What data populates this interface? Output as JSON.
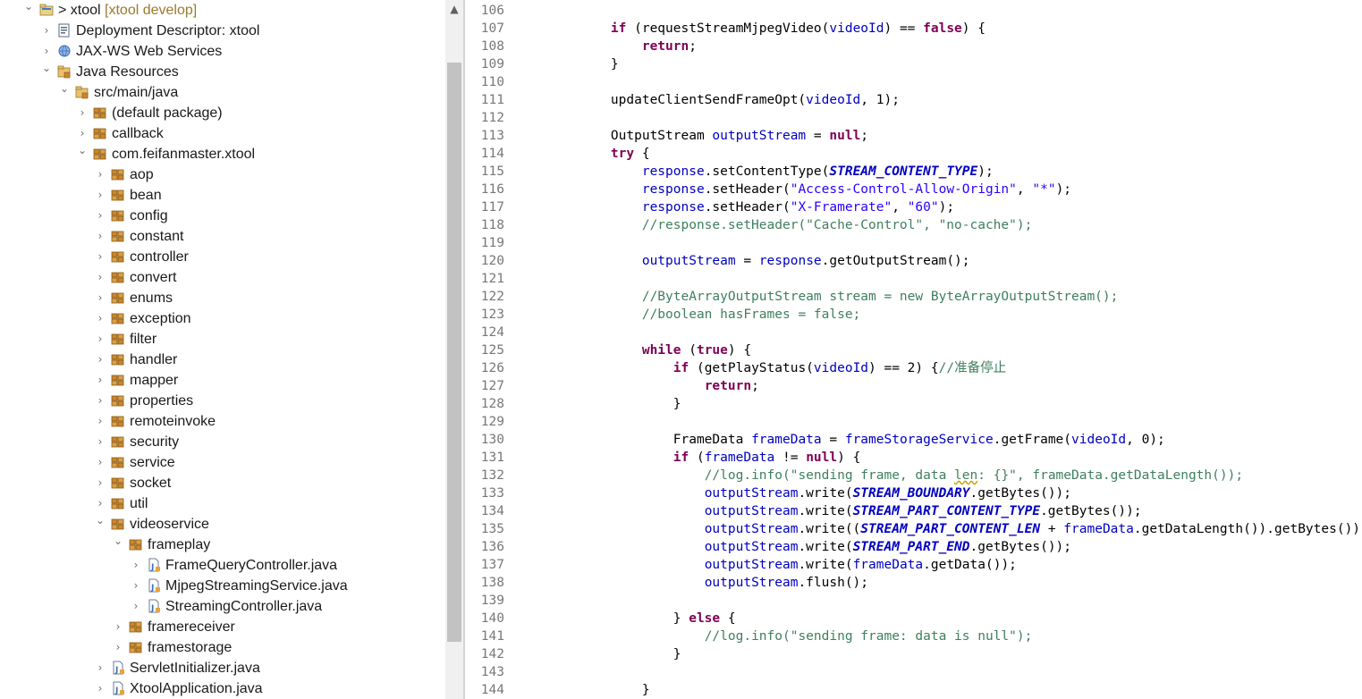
{
  "tree": {
    "items": [
      {
        "label": "> xtool",
        "suffix": " [xtool develop]",
        "depth": 0,
        "expanded": true,
        "icon": "project-icon"
      },
      {
        "label": "Deployment Descriptor: xtool",
        "depth": 1,
        "expanded": false,
        "icon": "deployment-descriptor-icon"
      },
      {
        "label": "JAX-WS Web Services",
        "depth": 1,
        "expanded": false,
        "icon": "web-services-icon"
      },
      {
        "label": "Java Resources",
        "depth": 1,
        "expanded": true,
        "icon": "java-resources-icon"
      },
      {
        "label": "src/main/java",
        "depth": 2,
        "expanded": true,
        "icon": "source-folder-icon"
      },
      {
        "label": "(default package)",
        "depth": 3,
        "expanded": false,
        "icon": "package-icon"
      },
      {
        "label": "callback",
        "depth": 3,
        "expanded": false,
        "icon": "package-icon"
      },
      {
        "label": "com.feifanmaster.xtool",
        "depth": 3,
        "expanded": true,
        "icon": "package-icon"
      },
      {
        "label": "aop",
        "depth": 4,
        "expanded": false,
        "icon": "package-icon"
      },
      {
        "label": "bean",
        "depth": 4,
        "expanded": false,
        "icon": "package-icon"
      },
      {
        "label": "config",
        "depth": 4,
        "expanded": false,
        "icon": "package-icon"
      },
      {
        "label": "constant",
        "depth": 4,
        "expanded": false,
        "icon": "package-icon"
      },
      {
        "label": "controller",
        "depth": 4,
        "expanded": false,
        "icon": "package-icon"
      },
      {
        "label": "convert",
        "depth": 4,
        "expanded": false,
        "icon": "package-icon"
      },
      {
        "label": "enums",
        "depth": 4,
        "expanded": false,
        "icon": "package-icon"
      },
      {
        "label": "exception",
        "depth": 4,
        "expanded": false,
        "icon": "package-icon"
      },
      {
        "label": "filter",
        "depth": 4,
        "expanded": false,
        "icon": "package-icon"
      },
      {
        "label": "handler",
        "depth": 4,
        "expanded": false,
        "icon": "package-icon"
      },
      {
        "label": "mapper",
        "depth": 4,
        "expanded": false,
        "icon": "package-icon"
      },
      {
        "label": "properties",
        "depth": 4,
        "expanded": false,
        "icon": "package-icon"
      },
      {
        "label": "remoteinvoke",
        "depth": 4,
        "expanded": false,
        "icon": "package-icon"
      },
      {
        "label": "security",
        "depth": 4,
        "expanded": false,
        "icon": "package-icon"
      },
      {
        "label": "service",
        "depth": 4,
        "expanded": false,
        "icon": "package-icon"
      },
      {
        "label": "socket",
        "depth": 4,
        "expanded": false,
        "icon": "package-icon"
      },
      {
        "label": "util",
        "depth": 4,
        "expanded": false,
        "icon": "package-icon"
      },
      {
        "label": "videoservice",
        "depth": 4,
        "expanded": true,
        "icon": "package-icon"
      },
      {
        "label": "frameplay",
        "depth": 5,
        "expanded": true,
        "icon": "package-icon"
      },
      {
        "label": "FrameQueryController.java",
        "depth": 6,
        "expanded": false,
        "icon": "java-file-icon"
      },
      {
        "label": "MjpegStreamingService.java",
        "depth": 6,
        "expanded": false,
        "icon": "java-file-icon"
      },
      {
        "label": "StreamingController.java",
        "depth": 6,
        "expanded": false,
        "icon": "java-file-icon"
      },
      {
        "label": "framereceiver",
        "depth": 5,
        "expanded": false,
        "icon": "package-icon"
      },
      {
        "label": "framestorage",
        "depth": 5,
        "expanded": false,
        "icon": "package-icon"
      },
      {
        "label": "ServletInitializer.java",
        "depth": 4,
        "expanded": false,
        "icon": "java-file-icon"
      },
      {
        "label": "XtoolApplication.java",
        "depth": 4,
        "expanded": false,
        "icon": "java-file-icon"
      }
    ]
  },
  "scrollbar": {
    "up_arrow_icon": "scroll-up-icon"
  },
  "colors": {
    "keyword": "#7f0055",
    "field": "#0000c0",
    "string": "#2a00ff",
    "comment": "#3f7f5f",
    "line_number": "#787878"
  },
  "editor": {
    "lines": [
      {
        "n": "106",
        "tokens": []
      },
      {
        "n": "107",
        "tokens": [
          [
            "    ",
            ""
          ],
          [
            "if",
            "kw"
          ],
          [
            " (requestStreamMjpegVideo(",
            ""
          ],
          [
            "videoId",
            "pv"
          ],
          [
            ") == ",
            ""
          ],
          [
            "false",
            "kw"
          ],
          [
            ") {",
            ""
          ]
        ]
      },
      {
        "n": "108",
        "tokens": [
          [
            "        ",
            ""
          ],
          [
            "return",
            "kw"
          ],
          [
            ";",
            ""
          ]
        ]
      },
      {
        "n": "109",
        "tokens": [
          [
            "    }",
            ""
          ]
        ]
      },
      {
        "n": "110",
        "tokens": []
      },
      {
        "n": "111",
        "tokens": [
          [
            "    updateClientSendFrameOpt(",
            ""
          ],
          [
            "videoId",
            "pv"
          ],
          [
            ", 1);",
            ""
          ]
        ]
      },
      {
        "n": "112",
        "tokens": []
      },
      {
        "n": "113",
        "tokens": [
          [
            "    OutputStream ",
            ""
          ],
          [
            "outputStream",
            "pv"
          ],
          [
            " = ",
            ""
          ],
          [
            "null",
            "kw"
          ],
          [
            ";",
            ""
          ]
        ]
      },
      {
        "n": "114",
        "tokens": [
          [
            "    ",
            ""
          ],
          [
            "try",
            "kw"
          ],
          [
            " {",
            ""
          ]
        ]
      },
      {
        "n": "115",
        "tokens": [
          [
            "        ",
            ""
          ],
          [
            "response",
            "pv"
          ],
          [
            ".setContentType(",
            ""
          ],
          [
            "STREAM_CONTENT_TYPE",
            "cst"
          ],
          [
            ");",
            ""
          ]
        ]
      },
      {
        "n": "116",
        "tokens": [
          [
            "        ",
            ""
          ],
          [
            "response",
            "pv"
          ],
          [
            ".setHeader(",
            ""
          ],
          [
            "\"Access-Control-Allow-Origin\"",
            "str"
          ],
          [
            ", ",
            ""
          ],
          [
            "\"*\"",
            "str"
          ],
          [
            ");",
            ""
          ]
        ]
      },
      {
        "n": "117",
        "tokens": [
          [
            "        ",
            ""
          ],
          [
            "response",
            "pv"
          ],
          [
            ".setHeader(",
            ""
          ],
          [
            "\"X-Framerate\"",
            "str"
          ],
          [
            ", ",
            ""
          ],
          [
            "\"60\"",
            "str"
          ],
          [
            ");",
            ""
          ]
        ]
      },
      {
        "n": "118",
        "tokens": [
          [
            "        ",
            ""
          ],
          [
            "//response.setHeader(\"Cache-Control\", \"no-cache\");",
            "cmt"
          ]
        ]
      },
      {
        "n": "119",
        "tokens": []
      },
      {
        "n": "120",
        "tokens": [
          [
            "        ",
            ""
          ],
          [
            "outputStream",
            "pv"
          ],
          [
            " = ",
            ""
          ],
          [
            "response",
            "pv"
          ],
          [
            ".getOutputStream();",
            ""
          ]
        ]
      },
      {
        "n": "121",
        "tokens": []
      },
      {
        "n": "122",
        "tokens": [
          [
            "        ",
            ""
          ],
          [
            "//ByteArrayOutputStream stream = new ByteArrayOutputStream();",
            "cmt"
          ]
        ]
      },
      {
        "n": "123",
        "tokens": [
          [
            "        ",
            ""
          ],
          [
            "//boolean hasFrames = false;",
            "cmt"
          ]
        ]
      },
      {
        "n": "124",
        "tokens": []
      },
      {
        "n": "125",
        "tokens": [
          [
            "        ",
            ""
          ],
          [
            "while",
            "kw"
          ],
          [
            " (",
            ""
          ],
          [
            "true",
            "kw"
          ],
          [
            ") {",
            ""
          ]
        ]
      },
      {
        "n": "126",
        "tokens": [
          [
            "            ",
            ""
          ],
          [
            "if",
            "kw"
          ],
          [
            " (getPlayStatus(",
            ""
          ],
          [
            "videoId",
            "pv"
          ],
          [
            ") == 2) {",
            ""
          ],
          [
            "//准备停止",
            "cmt"
          ]
        ]
      },
      {
        "n": "127",
        "tokens": [
          [
            "                ",
            ""
          ],
          [
            "return",
            "kw"
          ],
          [
            ";",
            ""
          ]
        ]
      },
      {
        "n": "128",
        "tokens": [
          [
            "            }",
            ""
          ]
        ]
      },
      {
        "n": "129",
        "tokens": []
      },
      {
        "n": "130",
        "tokens": [
          [
            "            FrameData ",
            ""
          ],
          [
            "frameData",
            "pv"
          ],
          [
            " = ",
            ""
          ],
          [
            "frameStorageService",
            "fld"
          ],
          [
            ".getFrame(",
            ""
          ],
          [
            "videoId",
            "pv"
          ],
          [
            ", 0);",
            ""
          ]
        ]
      },
      {
        "n": "131",
        "tokens": [
          [
            "            ",
            ""
          ],
          [
            "if",
            "kw"
          ],
          [
            " (",
            ""
          ],
          [
            "frameData",
            "pv"
          ],
          [
            " != ",
            ""
          ],
          [
            "null",
            "kw"
          ],
          [
            ") {",
            ""
          ]
        ]
      },
      {
        "n": "132",
        "tokens": [
          [
            "                ",
            ""
          ],
          [
            "//log.info(\"sending frame, data ",
            "cmt"
          ],
          [
            "len",
            "cmtw"
          ],
          [
            ": {}\", frameData.getDataLength());",
            "cmt"
          ]
        ]
      },
      {
        "n": "133",
        "tokens": [
          [
            "                ",
            ""
          ],
          [
            "outputStream",
            "pv"
          ],
          [
            ".write(",
            ""
          ],
          [
            "STREAM_BOUNDARY",
            "cst"
          ],
          [
            ".getBytes());",
            ""
          ]
        ]
      },
      {
        "n": "134",
        "tokens": [
          [
            "                ",
            ""
          ],
          [
            "outputStream",
            "pv"
          ],
          [
            ".write(",
            ""
          ],
          [
            "STREAM_PART_CONTENT_TYPE",
            "cst"
          ],
          [
            ".getBytes());",
            ""
          ]
        ]
      },
      {
        "n": "135",
        "tokens": [
          [
            "                ",
            ""
          ],
          [
            "outputStream",
            "pv"
          ],
          [
            ".write((",
            ""
          ],
          [
            "STREAM_PART_CONTENT_LEN",
            "cst"
          ],
          [
            " + ",
            ""
          ],
          [
            "frameData",
            "pv"
          ],
          [
            ".getDataLength()).getBytes());",
            ""
          ]
        ]
      },
      {
        "n": "136",
        "tokens": [
          [
            "                ",
            ""
          ],
          [
            "outputStream",
            "pv"
          ],
          [
            ".write(",
            ""
          ],
          [
            "STREAM_PART_END",
            "cst"
          ],
          [
            ".getBytes());",
            ""
          ]
        ]
      },
      {
        "n": "137",
        "tokens": [
          [
            "                ",
            ""
          ],
          [
            "outputStream",
            "pv"
          ],
          [
            ".write(",
            ""
          ],
          [
            "frameData",
            "pv"
          ],
          [
            ".getData());",
            ""
          ]
        ]
      },
      {
        "n": "138",
        "tokens": [
          [
            "                ",
            ""
          ],
          [
            "outputStream",
            "pv"
          ],
          [
            ".flush();",
            ""
          ]
        ]
      },
      {
        "n": "139",
        "tokens": []
      },
      {
        "n": "140",
        "tokens": [
          [
            "            } ",
            ""
          ],
          [
            "else",
            "kw"
          ],
          [
            " {",
            ""
          ]
        ]
      },
      {
        "n": "141",
        "tokens": [
          [
            "                ",
            ""
          ],
          [
            "//log.info(\"sending frame: data is null\");",
            "cmt"
          ]
        ]
      },
      {
        "n": "142",
        "tokens": [
          [
            "            }",
            ""
          ]
        ]
      },
      {
        "n": "143",
        "tokens": []
      },
      {
        "n": "144",
        "tokens": [
          [
            "        }",
            ""
          ]
        ]
      }
    ]
  }
}
